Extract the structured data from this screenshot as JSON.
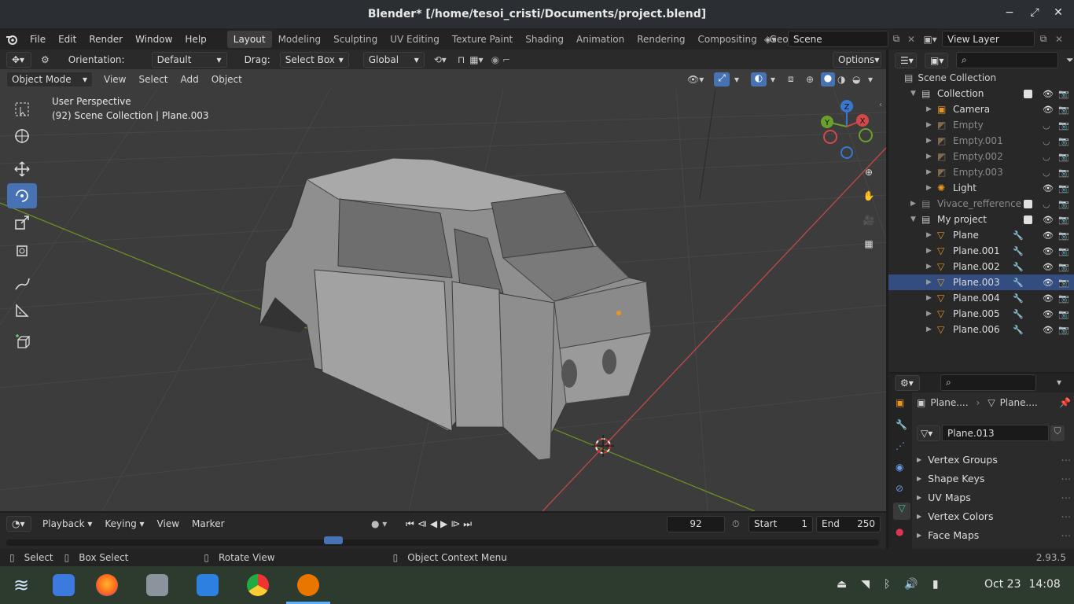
{
  "title": "Blender* [/home/tesoi_cristi/Documents/project.blend]",
  "window_controls": {
    "minimize": "−",
    "maximize": "⤢",
    "close": "✕"
  },
  "menus": [
    "File",
    "Edit",
    "Render",
    "Window",
    "Help"
  ],
  "workspaces": [
    "Layout",
    "Modeling",
    "Sculpting",
    "UV Editing",
    "Texture Paint",
    "Shading",
    "Animation",
    "Rendering",
    "Compositing",
    "Geometry Nod"
  ],
  "scene": {
    "label": "Scene",
    "view_layer": "View Layer"
  },
  "tool_header": {
    "orientation_label": "Orientation:",
    "orientation_value": "Default",
    "drag_label": "Drag:",
    "drag_value": "Select Box",
    "transform_orientation": "Global",
    "options": "Options"
  },
  "view_header": {
    "mode": "Object Mode",
    "view": "View",
    "select": "Select",
    "add": "Add",
    "object": "Object"
  },
  "viewport_info": {
    "perspective": "User Perspective",
    "context": "(92) Scene Collection | Plane.003"
  },
  "gizmo": {
    "z": "Z",
    "y": "Y",
    "x": "X"
  },
  "outliner": {
    "root": "Scene Collection",
    "rows": [
      {
        "name": "Collection",
        "indent": 1,
        "type": "collection",
        "dim": false
      },
      {
        "name": "Camera",
        "indent": 2,
        "type": "camera",
        "dim": false
      },
      {
        "name": "Empty",
        "indent": 2,
        "type": "empty",
        "dim": true
      },
      {
        "name": "Empty.001",
        "indent": 2,
        "type": "empty",
        "dim": true
      },
      {
        "name": "Empty.002",
        "indent": 2,
        "type": "empty",
        "dim": true
      },
      {
        "name": "Empty.003",
        "indent": 2,
        "type": "empty",
        "dim": true
      },
      {
        "name": "Light",
        "indent": 2,
        "type": "light",
        "dim": false
      },
      {
        "name": "Vivace_refference",
        "indent": 1,
        "type": "collection",
        "dim": true
      },
      {
        "name": "My project",
        "indent": 1,
        "type": "collection",
        "dim": false
      },
      {
        "name": "Plane",
        "indent": 2,
        "type": "mesh",
        "dim": false
      },
      {
        "name": "Plane.001",
        "indent": 2,
        "type": "mesh",
        "dim": false
      },
      {
        "name": "Plane.002",
        "indent": 2,
        "type": "mesh",
        "dim": false
      },
      {
        "name": "Plane.003",
        "indent": 2,
        "type": "mesh",
        "dim": false
      },
      {
        "name": "Plane.004",
        "indent": 2,
        "type": "mesh",
        "dim": false
      },
      {
        "name": "Plane.005",
        "indent": 2,
        "type": "mesh",
        "dim": false
      },
      {
        "name": "Plane.006",
        "indent": 2,
        "type": "mesh",
        "dim": false
      }
    ]
  },
  "properties": {
    "breadcrumb_object": "Plane....",
    "breadcrumb_data": "Plane....",
    "datablock": "Plane.013",
    "panels": [
      "Vertex Groups",
      "Shape Keys",
      "UV Maps",
      "Vertex Colors",
      "Face Maps"
    ]
  },
  "timeline": {
    "playback": "Playback",
    "keying": "Keying",
    "view": "View",
    "marker": "Marker",
    "current_frame": "92",
    "start_label": "Start",
    "start_value": "1",
    "end_label": "End",
    "end_value": "250"
  },
  "statusbar": {
    "select": "Select",
    "box_select": "Box Select",
    "rotate_view": "Rotate View",
    "context_menu": "Object Context Menu",
    "version": "2.93.5"
  },
  "taskbar": {
    "date": "Oct 23",
    "time": "14:08"
  },
  "colors": {
    "accent": "#4772b3",
    "bg": "#1d1d1d",
    "viewport": "#3c3c3c"
  }
}
